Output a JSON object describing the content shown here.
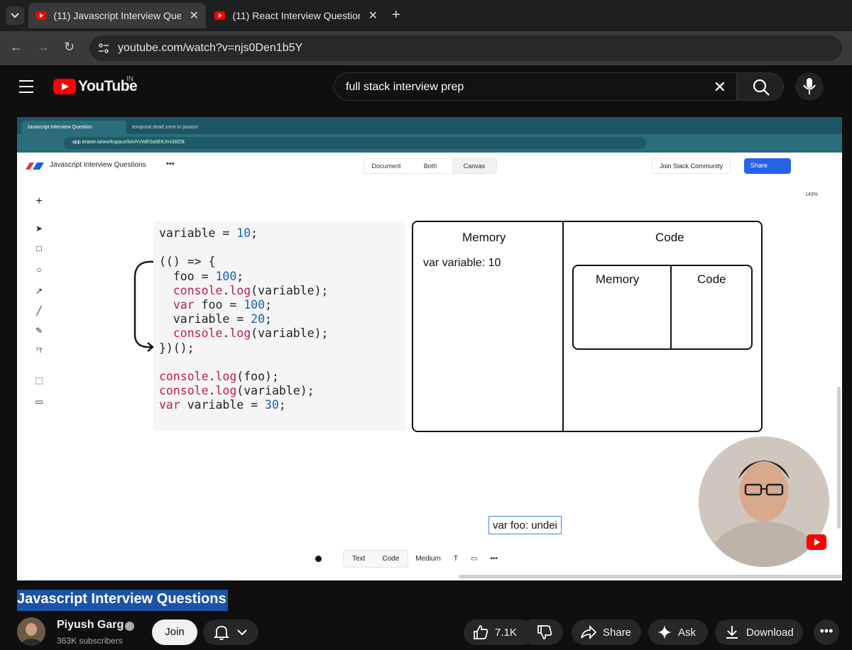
{
  "browser": {
    "tabs": [
      {
        "label": "(11) Javascript Interview Questio",
        "active": true
      },
      {
        "label": "(11) React Interview Questions -",
        "active": false
      }
    ],
    "url": "youtube.com/watch?v=njs0Den1b5Y"
  },
  "youtube": {
    "logo_word": "YouTube",
    "region": "IN",
    "search_value": "full stack interview prep"
  },
  "video": {
    "inner_tabs": [
      "Javascript Interview Question",
      "temporal dead zone in javascr"
    ],
    "inner_url_host": "app.eraser.io",
    "inner_url_path": "/workspace/8ArhVWE0a6E8Jmi38lZB",
    "app_title": "Javascript Interview Questions",
    "view_modes": [
      "Document",
      "Both",
      "Canvas"
    ],
    "join_slack": "Join Slack Community",
    "share": "Share",
    "zoom": "143%",
    "code_lines": [
      "variable = 10;",
      "",
      "(() => {",
      "  foo = 100;",
      "  console.log(variable);",
      "  var foo = 100;",
      "  variable = 20;",
      "  console.log(variable);",
      "})();",
      "",
      "console.log(foo);",
      "console.log(variable);",
      "var variable = 30;"
    ],
    "diagram": {
      "memory_label": "Memory",
      "code_label": "Code",
      "memory_entry": "var variable: 10",
      "inner_memory_label": "Memory",
      "inner_code_label": "Code"
    },
    "textbox_value": "var foo: undei",
    "format_bar": {
      "text": "Text",
      "code": "Code",
      "size": "Medium",
      "type": "T"
    }
  },
  "below": {
    "title": "Javascript Interview Questions",
    "channel": "Piyush Garg",
    "subscribers": "363K subscribers",
    "join": "Join",
    "likes": "7.1K",
    "share": "Share",
    "ask": "Ask",
    "download": "Download"
  },
  "colors": {
    "accent_red": "#ff0000",
    "title_highlight": "#1b53a8",
    "eraser_share_blue": "#2563eb"
  }
}
